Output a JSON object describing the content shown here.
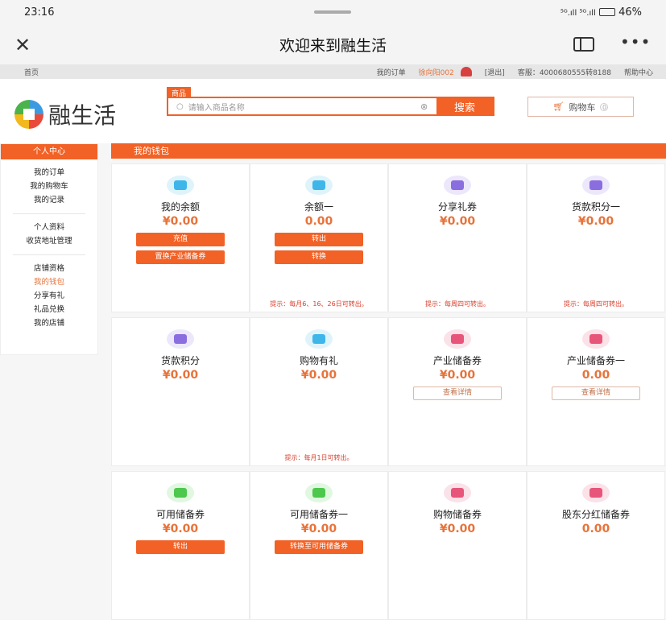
{
  "status": {
    "time": "23:16",
    "signal": "⁵ᴳ.ıll ⁵ᴳ.ıll",
    "battery": "46%"
  },
  "titlebar": {
    "title": "欢迎来到融生活"
  },
  "topnav": {
    "home": "首页",
    "orders": "我的订单",
    "user": "徐向阳002",
    "logout": "[退出]",
    "service": "客服：4000680555转8188",
    "help": "帮助中心"
  },
  "header": {
    "logo_text": "融生活",
    "search_tab": "商品",
    "search_placeholder": "请输入商品名称",
    "search_button": "搜索",
    "cart": "购物车",
    "cart_count": "0"
  },
  "sidebar": {
    "title": "个人中心",
    "groups": [
      [
        "我的订单",
        "我的购物车",
        "我的记录"
      ],
      [
        "个人资料",
        "收货地址管理"
      ],
      [
        "店铺资格",
        "我的钱包",
        "分享有礼",
        "礼品兑换",
        "我的店铺"
      ]
    ],
    "active": "我的钱包"
  },
  "main": {
    "title": "我的钱包",
    "cards": [
      {
        "icon": "money-bag-icon",
        "color": "#3eb6ea",
        "bg": "#dff3fb",
        "label": "我的余额",
        "value": "¥0.00",
        "buttons": [
          "充值",
          "置换产业储备券"
        ],
        "tip": ""
      },
      {
        "icon": "money-bag-icon",
        "color": "#3eb6ea",
        "bg": "#dff3fb",
        "label": "余额一",
        "value": "0.00",
        "buttons": [
          "转出",
          "转换"
        ],
        "tip": "提示：每月6、16、26日可转出。"
      },
      {
        "icon": "wallet-icon",
        "color": "#8a6ee0",
        "bg": "#ece7fb",
        "label": "分享礼券",
        "value": "¥0.00",
        "buttons": [],
        "tip": "提示：每周四可转出。"
      },
      {
        "icon": "wallet-icon",
        "color": "#8a6ee0",
        "bg": "#ece7fb",
        "label": "货款积分一",
        "value": "¥0.00",
        "buttons": [],
        "tip": "提示：每周四可转出。"
      },
      {
        "icon": "wallet-icon",
        "color": "#8a6ee0",
        "bg": "#ece7fb",
        "label": "货款积分",
        "value": "¥0.00",
        "buttons": [],
        "tip": ""
      },
      {
        "icon": "money-bag-icon",
        "color": "#3eb6ea",
        "bg": "#dff3fb",
        "label": "购物有礼",
        "value": "¥0.00",
        "buttons": [],
        "tip": "提示：每月1日可转出。"
      },
      {
        "icon": "ticket-icon",
        "color": "#e8557a",
        "bg": "#fbe1e8",
        "label": "产业储备券",
        "value": "¥0.00",
        "outline": [
          "查看详情"
        ],
        "buttons": [],
        "tip": ""
      },
      {
        "icon": "ticket-icon",
        "color": "#e8557a",
        "bg": "#fbe1e8",
        "label": "产业储备券一",
        "value": "0.00",
        "outline": [
          "查看详情"
        ],
        "buttons": [],
        "tip": ""
      },
      {
        "icon": "ticket-icon",
        "color": "#4cc84c",
        "bg": "#e0f7e0",
        "label": "可用储备券",
        "value": "¥0.00",
        "buttons": [
          "转出"
        ],
        "tip": ""
      },
      {
        "icon": "ticket-icon",
        "color": "#4cc84c",
        "bg": "#e0f7e0",
        "label": "可用储备券一",
        "value": "¥0.00",
        "buttons": [
          "转换至可用储备券"
        ],
        "tip": ""
      },
      {
        "icon": "ticket-icon",
        "color": "#e8557a",
        "bg": "#fbe1e8",
        "label": "购物储备券",
        "value": "¥0.00",
        "buttons": [],
        "tip": ""
      },
      {
        "icon": "ticket-icon",
        "color": "#e8557a",
        "bg": "#fbe1e8",
        "label": "股东分红储备券",
        "value": "0.00",
        "buttons": [],
        "tip": ""
      }
    ]
  },
  "colors": {
    "accent": "#f26125",
    "value": "#e8733a"
  }
}
